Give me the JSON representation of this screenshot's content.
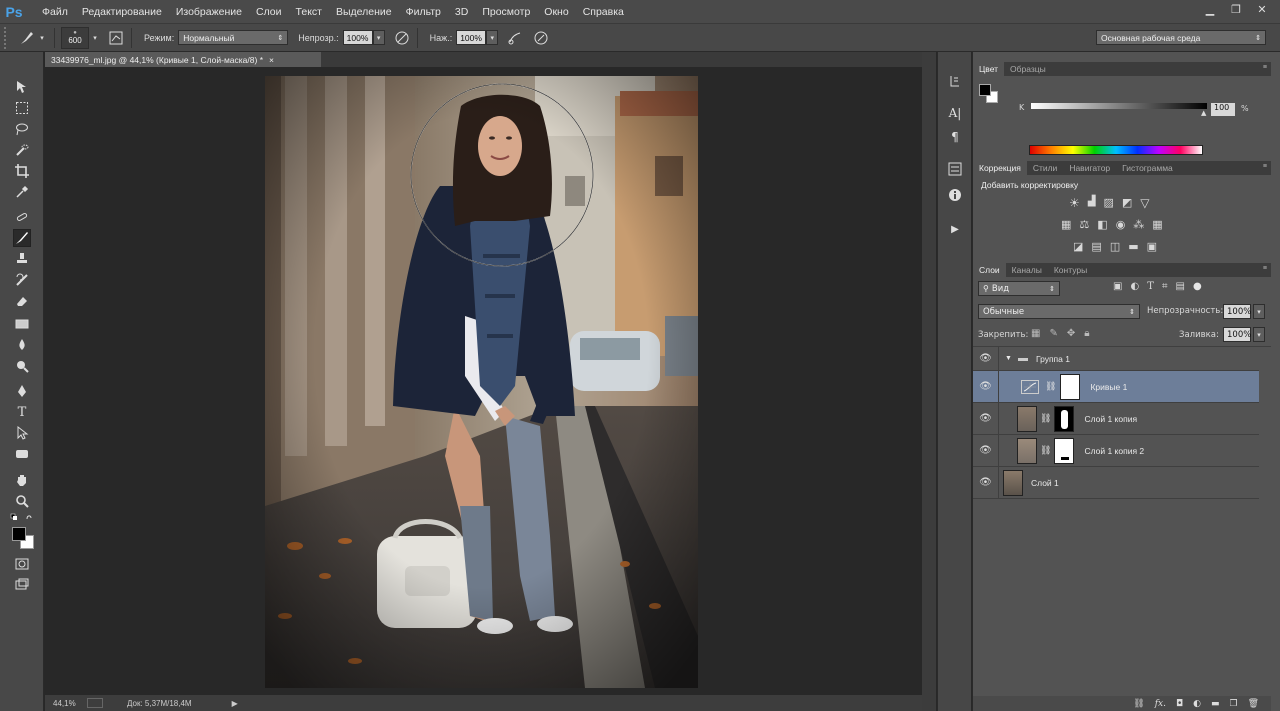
{
  "menubar": {
    "logo": "Ps",
    "items": [
      "Файл",
      "Редактирование",
      "Изображение",
      "Слои",
      "Текст",
      "Выделение",
      "Фильтр",
      "3D",
      "Просмотр",
      "Окно",
      "Справка"
    ]
  },
  "options": {
    "brush_size": "600",
    "mode_label": "Режим:",
    "mode_value": "Нормальный",
    "opacity_label": "Непрозр.:",
    "opacity_value": "100%",
    "pressure_label": "Наж.:",
    "pressure_value": "100%",
    "workspace": "Основная рабочая среда"
  },
  "document": {
    "tab_title": "33439976_ml.jpg @ 44,1% (Кривые 1, Слой-маска/8) *",
    "tab_close": "×",
    "zoom": "44,1%",
    "doc_info": "Док: 5,37M/18,4M"
  },
  "color_panel": {
    "tabs": [
      "Цвет",
      "Образцы"
    ],
    "channel_label": "K",
    "value": "100",
    "unit": "%"
  },
  "adjust_panel": {
    "tabs": [
      "Коррекция",
      "Стили",
      "Навигатор",
      "Гистограмма"
    ],
    "heading": "Добавить корректировку"
  },
  "layers_panel": {
    "tabs": [
      "Слои",
      "Каналы",
      "Контуры"
    ],
    "filter": "Вид",
    "blend_mode": "Обычные",
    "opacity_label": "Непрозрачность:",
    "opacity_value": "100%",
    "lock_label": "Закрепить:",
    "fill_label": "Заливка:",
    "fill_value": "100%",
    "group_name": "Группа 1",
    "layers": [
      {
        "name": "Кривые 1",
        "selected": true
      },
      {
        "name": "Слой 1 копия",
        "selected": false
      },
      {
        "name": "Слой 1 копия 2",
        "selected": false
      },
      {
        "name": "Слой 1",
        "selected": false
      }
    ]
  },
  "colors": {
    "accent_ps": "#4aa3e8",
    "selected_layer": "#6d7e99"
  }
}
